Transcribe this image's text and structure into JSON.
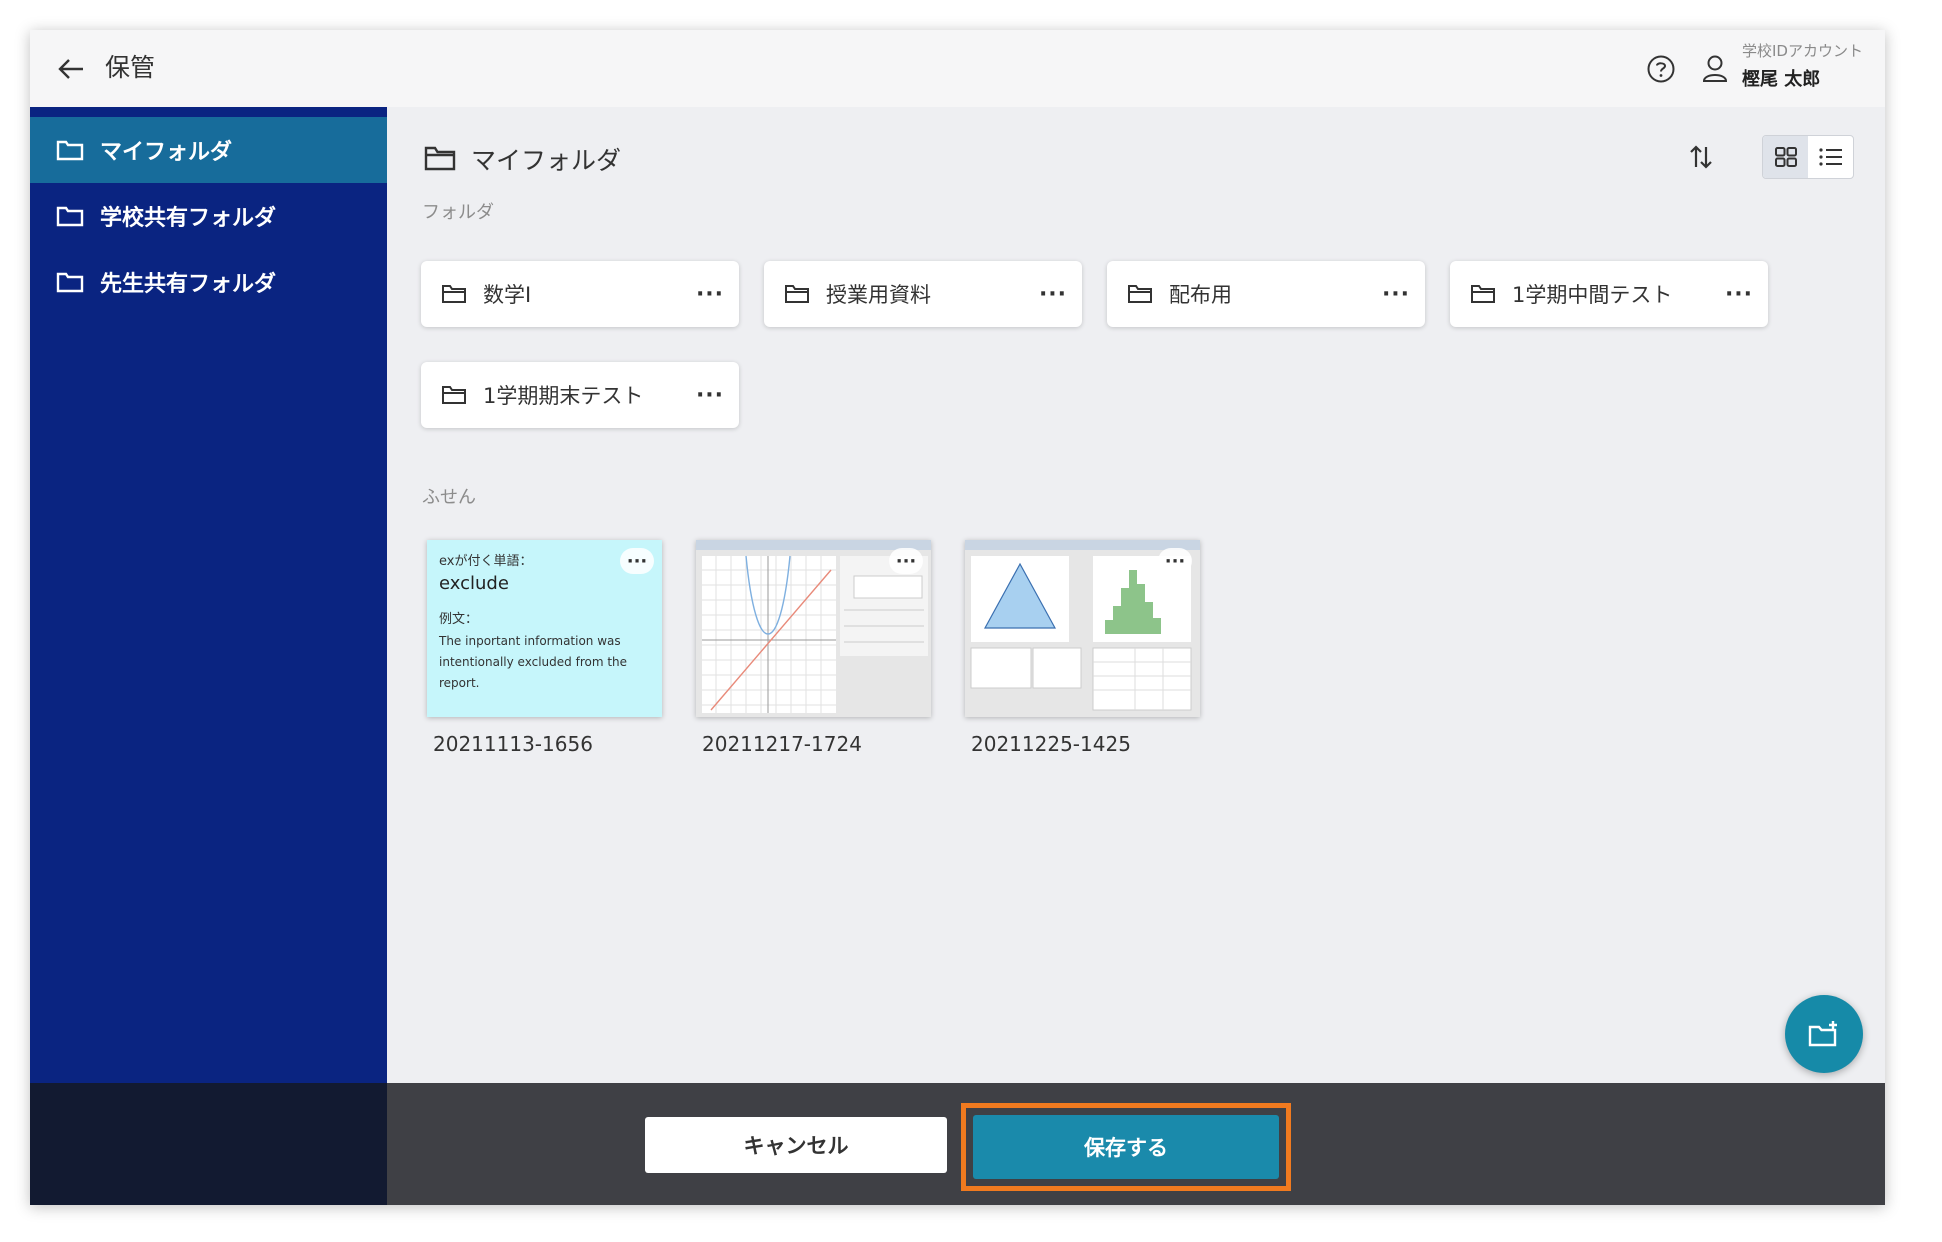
{
  "header": {
    "title": "保管",
    "account_label": "学校IDアカウント",
    "user_name": "樫尾 太郎"
  },
  "sidebar": {
    "items": [
      {
        "label": "マイフォルダ",
        "active": true
      },
      {
        "label": "学校共有フォルダ",
        "active": false
      },
      {
        "label": "先生共有フォルダ",
        "active": false
      }
    ]
  },
  "main": {
    "title": "マイフォルダ",
    "folders_label": "フォルダ",
    "notes_label": "ふせん",
    "folders": [
      {
        "name": "数学Ⅰ"
      },
      {
        "name": "授業用資料"
      },
      {
        "name": "配布用"
      },
      {
        "name": "1学期中間テスト"
      },
      {
        "name": "1学期期末テスト"
      }
    ],
    "notes": [
      {
        "date": "20211113-1656",
        "type": "sticky",
        "line1": "exが付く単語：",
        "word": "exclude",
        "example_label": "例文：",
        "example_text": "The inportant information was intentionally excluded from the report."
      },
      {
        "date": "20211217-1724",
        "type": "graph"
      },
      {
        "date": "20211225-1425",
        "type": "stats"
      }
    ],
    "more_label": "···"
  },
  "footer": {
    "cancel_label": "キャンセル",
    "save_label": "保存する"
  },
  "colors": {
    "sidebar_bg": "#0a2481",
    "sidebar_active": "#176c9b",
    "accent": "#1a8aab",
    "highlight": "#f07a1f",
    "sticky_bg": "#c6f6fb"
  }
}
